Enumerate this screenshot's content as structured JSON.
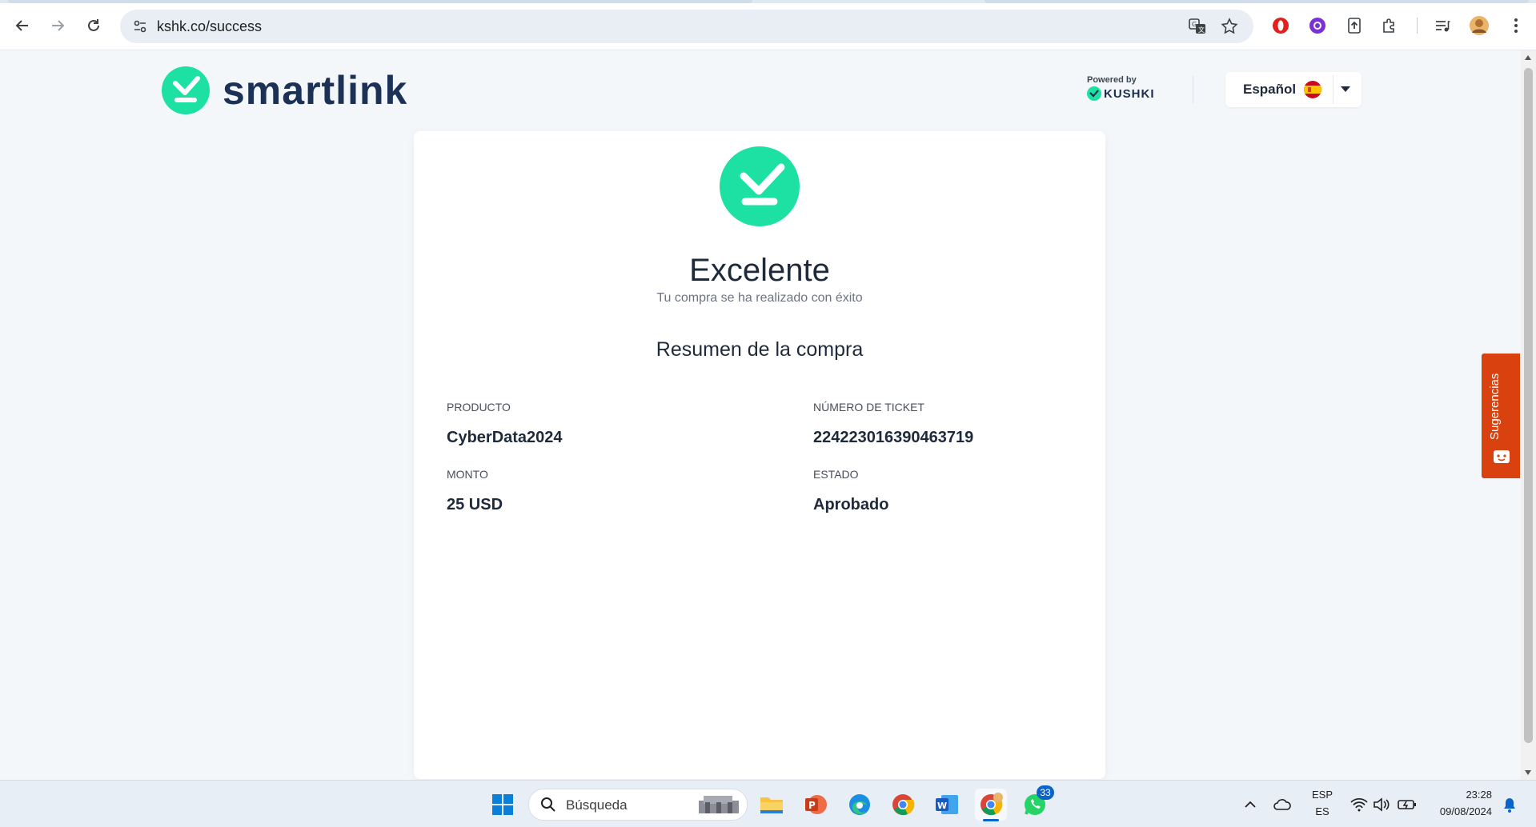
{
  "browser": {
    "url": "kshk.co/success"
  },
  "header": {
    "logo_text": "smartlink",
    "powered_by": "Powered by",
    "powered_brand": "KUSHKI",
    "language": "Español"
  },
  "card": {
    "title": "Excelente",
    "subtitle": "Tu compra se ha realizado con éxito",
    "section_title": "Resumen de la compra",
    "fields": [
      {
        "label": "PRODUCTO",
        "value": "CyberData2024"
      },
      {
        "label": "NÚMERO DE TICKET",
        "value": "224223016390463719"
      },
      {
        "label": "MONTO",
        "value": "25 USD"
      },
      {
        "label": "ESTADO",
        "value": "Aprobado"
      }
    ]
  },
  "feedback": {
    "label": "Sugerencias"
  },
  "taskbar": {
    "search_placeholder": "Búsqueda",
    "whatsapp_badge": "33",
    "lang_top": "ESP",
    "lang_bottom": "ES",
    "time": "23:28",
    "date": "09/08/2024"
  },
  "colors": {
    "accent": "#1de0a3",
    "brand_dark": "#1b3155",
    "feedback": "#d9420f"
  }
}
